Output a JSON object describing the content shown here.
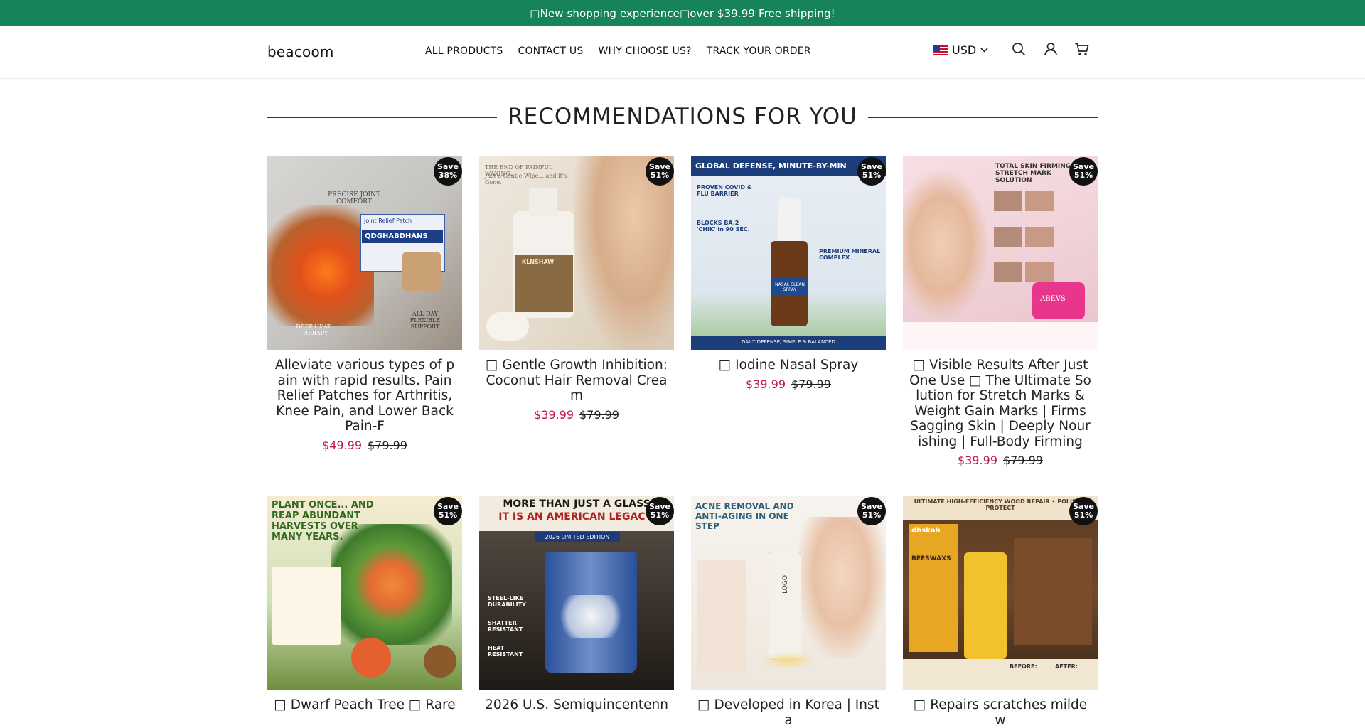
{
  "announcement": "□New shopping experience□over $39.99 Free shipping!",
  "header": {
    "logo": "beacoom",
    "nav": [
      "ALL PRODUCTS",
      "CONTACT US",
      "WHY CHOOSE US?",
      "TRACK YOUR ORDER"
    ],
    "currency": "USD",
    "icons": [
      "search-icon",
      "account-icon",
      "cart-icon"
    ]
  },
  "section_title": "RECOMMENDATIONS FOR YOU",
  "products": [
    {
      "title": "Alleviate various types of pain with rapid results. Pain Relief Patches for Arthritis, Knee Pain, and Lower Back Pain-F",
      "sale_price": "$49.99",
      "compare_price": "$79.99",
      "badge_line1": "Save",
      "badge_line2": "38%",
      "image_text": {
        "t1": "PRECISE JOINT COMFORT",
        "t2": "Joint Relief Patch",
        "t3": "QDGHABDHANS",
        "t4": "DEEP HEAT THERAPY",
        "t5": "ALL-DAY FLEXIBLE SUPPORT"
      }
    },
    {
      "title": "□ Gentle Growth Inhibition: Coconut Hair Removal Cream",
      "sale_price": "$39.99",
      "compare_price": "$79.99",
      "badge_line1": "Save",
      "badge_line2": "51%",
      "image_text": {
        "t1": "THE END OF PAINFUL WAXING.",
        "t2": "Just a Gentle Wipe... and it's Gone.",
        "t3": "KLNSHAW"
      }
    },
    {
      "title": "□ Iodine Nasal Spray",
      "sale_price": "$39.99",
      "compare_price": "$79.99",
      "badge_line1": "Save",
      "badge_line2": "51%",
      "image_text": {
        "t1": "GLOBAL DEFENSE, MINUTE-BY-MIN",
        "t2": "PROVEN COVID & FLU BARRIER",
        "t3": "BLOCKS BA.2 'CHIK' in 90 SEC.",
        "t4": "PREMIUM MINERAL COMPLEX",
        "t5": "NASAL CLEAN SPRAY",
        "t6": "DAILY DEFENSE, SIMPLE & BALANCED"
      }
    },
    {
      "title": "□ Visible Results After Just One Use □ The Ultimate Solution for Stretch Marks & Weight Gain Marks | Firms Sagging Skin | Deeply Nourishing | Full-Body Firming",
      "sale_price": "$39.99",
      "compare_price": "$79.99",
      "badge_line1": "Save",
      "badge_line2": "51%",
      "image_text": {
        "t1": "TOTAL SKIN FIRMING STRETCH MARK SOLUTION",
        "t2": "ABEVS"
      }
    },
    {
      "title": "□ Dwarf Peach Tree □ Rare",
      "badge_line1": "Save",
      "badge_line2": "51%",
      "image_text": {
        "t1": "PLANT ONCE... AND REAP ABUNDANT HARVESTS OVER MANY YEARS."
      }
    },
    {
      "title": "2026 U.S. Semiquincentenn",
      "badge_line1": "Save",
      "badge_line2": "51%",
      "image_text": {
        "t1": "MORE THAN JUST A GLASS",
        "t2": "IT IS AN AMERICAN LEGACY.",
        "t3": "2026 LIMITED EDITION",
        "t4": "STEEL-LIKE DURABILITY",
        "t5": "SHATTER RESISTANT",
        "t6": "HEAT RESISTANT"
      }
    },
    {
      "title": "□ Developed in Korea | Insta",
      "badge_line1": "Save",
      "badge_line2": "51%",
      "image_text": {
        "t1": "ACNE REMOVAL AND ANTI-AGING IN ONE STEP",
        "t2": "LOGO"
      }
    },
    {
      "title": "□ Repairs scratches mildew",
      "badge_line1": "Save",
      "badge_line2": "51%",
      "image_text": {
        "t1": "ULTIMATE HIGH-EFFICIENCY WOOD REPAIR • POLISH • PROTECT",
        "t2": "dhskah",
        "t3": "BEESWAXS",
        "t4": "BEFORE:",
        "t5": "AFTER:"
      }
    }
  ]
}
